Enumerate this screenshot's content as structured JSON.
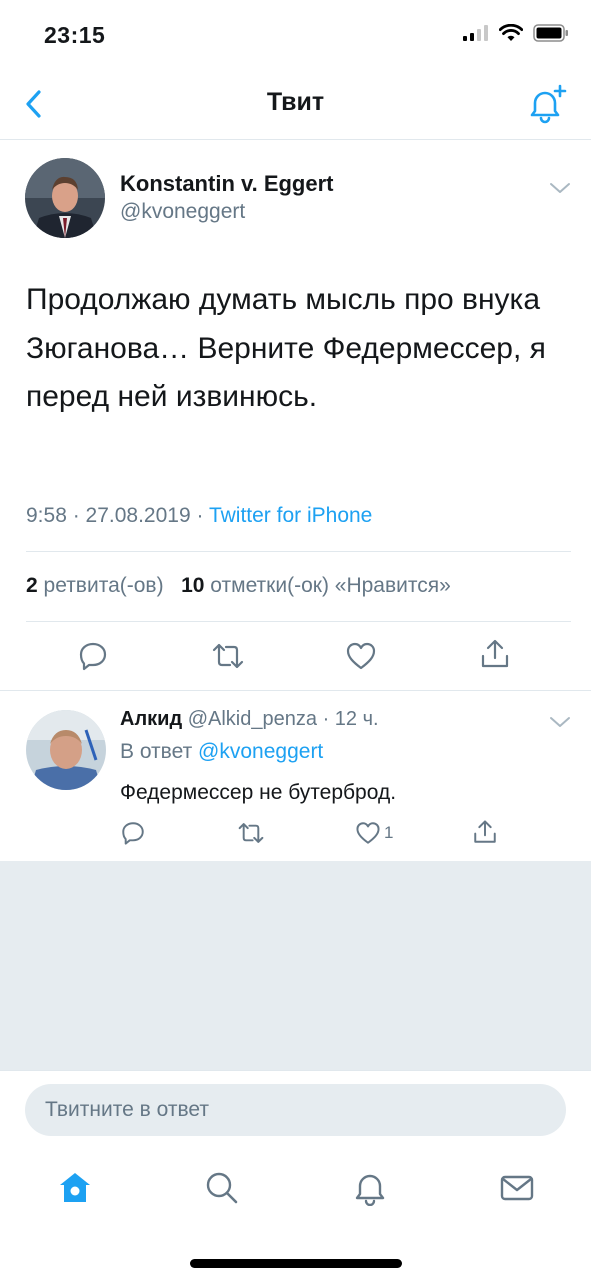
{
  "status_bar": {
    "time": "23:15"
  },
  "nav": {
    "title": "Твит"
  },
  "tweet": {
    "author_name": "Konstantin v. Eggert",
    "author_handle": "@kvoneggert",
    "text": "Продолжаю думать мысль про внука Зюганова… Верните Федермессер, я перед ней извинюсь.",
    "time": "9:58",
    "date": "27.08.2019",
    "source": "Twitter for iPhone",
    "retweets_count": "2",
    "retweets_label": "ретвита(-ов)",
    "likes_count": "10",
    "likes_label": "отметки(-ок) «Нравится»"
  },
  "reply": {
    "author_name": "Алкид",
    "author_handle": "@Alkid_penza",
    "time_ago": "12 ч.",
    "reply_to_label": "В ответ",
    "reply_to_handle": "@kvoneggert",
    "text": "Федермессер не бутерброд.",
    "like_count": "1"
  },
  "compose": {
    "placeholder": "Твитните в ответ"
  },
  "tabs": [
    "home-icon",
    "search-icon",
    "notifications-icon",
    "messages-icon"
  ],
  "colors": {
    "accent": "#1da1f2",
    "secondary_text": "#657786",
    "divider": "#e1e8ed",
    "background_grey": "#e6ecf0"
  }
}
